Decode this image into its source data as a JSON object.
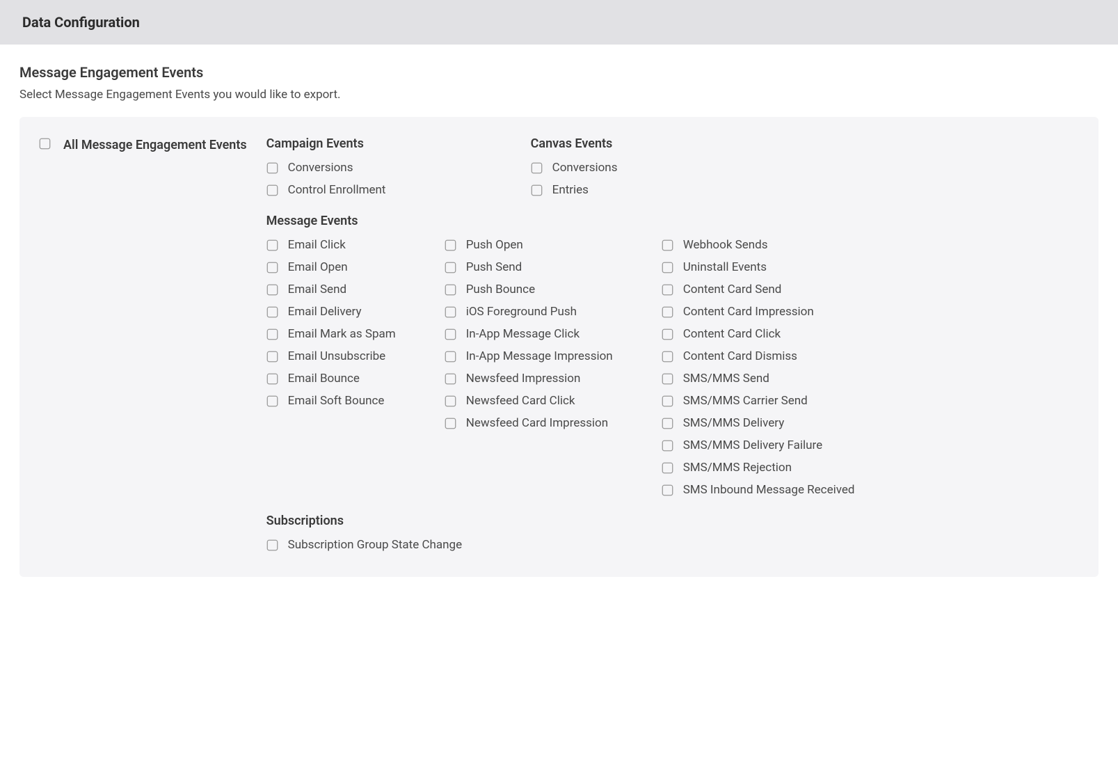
{
  "header": {
    "title": "Data Configuration"
  },
  "section": {
    "title": "Message Engagement Events",
    "description": "Select Message Engagement Events you would like to export."
  },
  "master": {
    "label": "All Message Engagement Events"
  },
  "groups": {
    "campaign": {
      "title": "Campaign Events",
      "items": [
        "Conversions",
        "Control Enrollment"
      ]
    },
    "canvas": {
      "title": "Canvas Events",
      "items": [
        "Conversions",
        "Entries"
      ]
    },
    "message": {
      "title": "Message Events",
      "col1": [
        "Email Click",
        "Email Open",
        "Email Send",
        "Email Delivery",
        "Email Mark as Spam",
        "Email Unsubscribe",
        "Email Bounce",
        "Email Soft Bounce"
      ],
      "col2": [
        "Push Open",
        "Push Send",
        "Push Bounce",
        "iOS Foreground Push",
        "In-App Message Click",
        "In-App Message Impression",
        "Newsfeed Impression",
        "Newsfeed Card Click",
        "Newsfeed Card Impression"
      ],
      "col3": [
        "Webhook Sends",
        "Uninstall Events",
        "Content Card Send",
        "Content Card Impression",
        "Content Card Click",
        "Content Card Dismiss",
        "SMS/MMS Send",
        "SMS/MMS Carrier Send",
        "SMS/MMS Delivery",
        "SMS/MMS Delivery Failure",
        "SMS/MMS Rejection",
        "SMS Inbound Message Received"
      ]
    },
    "subscriptions": {
      "title": "Subscriptions",
      "items": [
        "Subscription Group State Change"
      ]
    }
  }
}
